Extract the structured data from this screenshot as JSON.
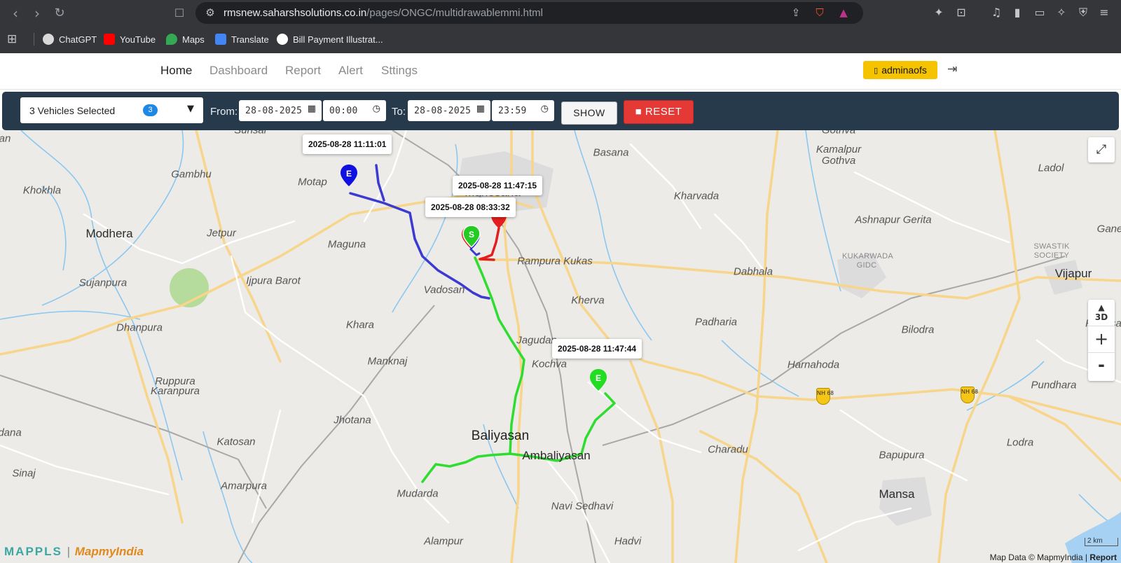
{
  "browser": {
    "url_host": "rmsnew.saharshsolutions.co.in",
    "url_path": "/pages/ONGC/multidrawablemmi.html",
    "bookmarks": [
      {
        "label": "ChatGPT",
        "color": "#d9d9d9"
      },
      {
        "label": "YouTube",
        "color": "#ff0000"
      },
      {
        "label": "Maps",
        "color": "#34a853"
      },
      {
        "label": "Translate",
        "color": "#4285f4"
      },
      {
        "label": "Bill Payment Illustrat...",
        "color": "#ffffff"
      }
    ]
  },
  "nav": {
    "links": [
      "Home",
      "Dashboard",
      "Report",
      "Alert",
      "Sttings"
    ],
    "active": "Home",
    "user": "adminaofs"
  },
  "filters": {
    "vehicles_label": "3 Vehicles Selected",
    "vehicles_count": "3",
    "from_label": "From:",
    "from_date": "28-08-2025",
    "from_time": "00:00",
    "to_label": "To:",
    "to_date": "28-08-2025",
    "to_time": "23:59",
    "show_label": "SHOW",
    "reset_label": "RESET"
  },
  "map": {
    "tooltips": [
      "2025-08-28 11:11:01",
      "2025-08-28 11:47:15",
      "2025-08-28 08:33:32",
      "2025-08-28 11:47:44"
    ],
    "markers": [
      {
        "letter": "E",
        "color": "#1010e0"
      },
      {
        "letter": "S",
        "color": "#22cc22"
      },
      {
        "letter": "E",
        "color": "#22dd22"
      }
    ],
    "route_colors": {
      "blue": "#3b3bd0",
      "green": "#2fdc2f",
      "red": "#e21e1e"
    },
    "places": [
      "Sunsar",
      "Basana",
      "Kamalpur Gothva",
      "Ladol",
      "Gambhu",
      "Motap",
      "Khokhla",
      "Kharvada",
      "Ashnapur Gerita",
      "Modhera",
      "Jetpur",
      "Maguna",
      "Rampura Kukas",
      "Dabhala",
      "Vijapur",
      "Sujanpura",
      "Ijpura Barot",
      "Vadosan",
      "Kherva",
      "Padharia",
      "Bilodra",
      "Dhanpura",
      "Khara",
      "Jagudan",
      "Ranasa",
      "Kochva",
      "Harnahoda",
      "Manknaj",
      "Pundhara",
      "Ruppura Karanpura",
      "Jhotana",
      "Baliyasan",
      "Katosan",
      "Charadu",
      "Lodra",
      "Ambaliyasan",
      "Bapupura",
      "Sinaj",
      "Amarpura",
      "Mudarda",
      "Navi Sedhavi",
      "Mansa",
      "Alampur",
      "Hadvi",
      "Gothva",
      "Gane",
      "dana"
    ],
    "area_labels": [
      "KUKARWADA GIDC",
      "SWASTIK SOCIETY",
      "NH 68"
    ],
    "controls": {
      "three_d": "3D",
      "zoom_in": "+",
      "zoom_out": "-"
    },
    "brand": "MAPPLS",
    "brand_sub": "MapmyIndia",
    "attribution": "Map Data © MapmyIndia |",
    "attribution_report": "Report",
    "scale": "2 km"
  }
}
